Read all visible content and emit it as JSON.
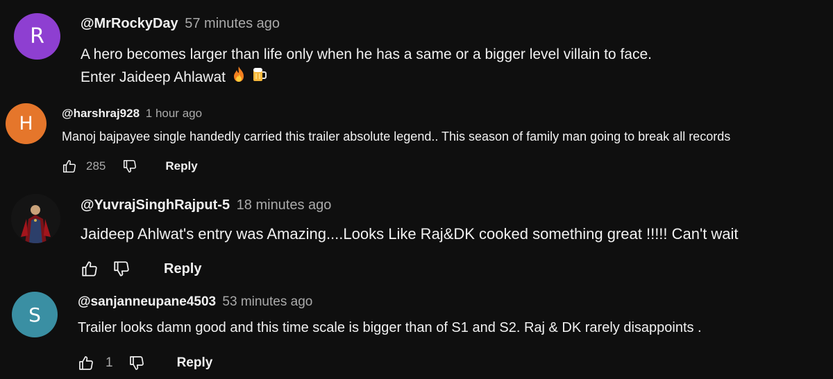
{
  "comments": [
    {
      "avatar_letter": "R",
      "avatar_color": "#8e3fd1",
      "handle": "@MrRockyDay",
      "time": "57 minutes ago",
      "lines": [
        "A hero becomes larger than life only when he has a same or a bigger level villain to face.",
        "Enter Jaideep Ahlawat"
      ],
      "emojis": [
        "fire-emoji",
        "beer-mug-emoji"
      ]
    },
    {
      "avatar_letter": "H",
      "avatar_color": "#e5762b",
      "handle": "@harshraj928",
      "time": "1 hour ago",
      "text": "Manoj bajpayee single handedly carried this trailer absolute legend.. This season of family man going to break all records",
      "likes": "285",
      "reply_label": "Reply"
    },
    {
      "avatar_image": "superhero-avatar",
      "handle": "@YuvrajSinghRajput-5",
      "time": "18 minutes ago",
      "text": "Jaideep Ahlwat's entry was Amazing....Looks Like Raj&DK cooked something great !!!!! Can't wait",
      "reply_label": "Reply"
    },
    {
      "avatar_letter": "S",
      "avatar_color": "#3a8fa3",
      "handle": "@sanjanneupane4503",
      "time": "53 minutes ago",
      "text": "Trailer looks damn good and this time scale is bigger than of S1 and S2. Raj & DK rarely disappoints .",
      "likes": "1",
      "reply_label": "Reply"
    }
  ],
  "icons": {
    "like": "thumbs-up-icon",
    "dislike": "thumbs-down-icon"
  },
  "theme": {
    "background": "#0f0f0f",
    "text": "#f1f1f1",
    "secondary_text": "#aaaaaa"
  }
}
